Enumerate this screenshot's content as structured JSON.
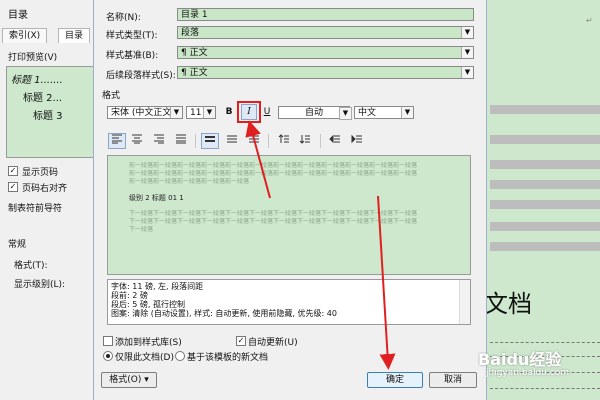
{
  "document": {
    "heading_tail": "文档"
  },
  "toc_dialog": {
    "title": "目录",
    "tabs": [
      "索引(X)",
      "目录"
    ],
    "print_preview_label": "打印预览(V)",
    "preview_lines": [
      "标题 1.......",
      "标题 2...",
      "标题 3"
    ],
    "show_page_numbers": "显示页码",
    "right_align": "页码右对齐",
    "tab_leader": "制表符前导符",
    "general": "常规",
    "formats": "格式(T):",
    "show_levels": "显示级别(L):"
  },
  "style_dialog": {
    "fields": {
      "name_label": "名称(N):",
      "name_value": "目录 1",
      "type_label": "样式类型(T):",
      "type_value": "段落",
      "based_label": "样式基准(B):",
      "based_value": "¶ 正文",
      "following_label": "后续段落样式(S):",
      "following_value": "¶ 正文"
    },
    "format_section": "格式",
    "font_name": "宋体 (中文正文)",
    "font_size": "11",
    "bold": "B",
    "italic": "I",
    "underline": "U",
    "color": "自动",
    "language": "中文",
    "preview": {
      "prev_para": "前一段落前一段落前一段落前一段落前一段落前一段落前一段落前一段落前一段落前一段落前一段落前一段落",
      "prev_para_2": "前一段落前一段落前一段落前一段落前一段落前一段落前一段落前一段落前一段落前一段落前一段落前一段落",
      "prev_para_3": "前一段落前一段落前一段落前一段落前一段落",
      "sample": "级别 2 标题 01      1",
      "next_para": "下一段落下一段落下一段落下一段落下一段落下一段落下一段落下一段落下一段落下一段落下一段落下一段落",
      "next_para_2": "下一段落下一段落下一段落下一段落下一段落下一段落下一段落下一段落下一段落下一段落下一段落下一段落",
      "next_para_3": "下一段落"
    },
    "description": [
      "字体: 11 磅, 左, 段落间距",
      "    段前: 2 磅",
      "    段后: 5 磅, 孤行控制",
      "    图案: 清除 (自动设置), 样式: 自动更新, 使用前隐藏, 优先级: 40"
    ],
    "add_to_gallery": "添加到样式库(S)",
    "auto_update": "自动更新(U)",
    "only_this_doc": "仅限此文档(D)",
    "new_docs_template": "基于该模板的新文档",
    "format_button": "格式(O) ▾",
    "ok_button": "确定",
    "cancel_button": "取消"
  },
  "watermark": {
    "brand": "Baidu经验",
    "url": "jingyan.baidu.com"
  },
  "colors": {
    "preview_green": "#cde8cd",
    "annotation_red": "#e02020"
  }
}
